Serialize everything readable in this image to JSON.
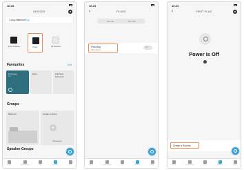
{
  "colors": {
    "accent": "#3aa3d8",
    "highlight": "#f08a55"
  },
  "screen1": {
    "time": "16:23",
    "title": "DEVICES",
    "location_label": "1 plug Hatterned",
    "location_value": "Plug",
    "device_types": [
      {
        "label": "Echo & Alexa",
        "icon": "echo-icon"
      },
      {
        "label": "Plugs",
        "icon": "plug-icon"
      },
      {
        "label": "All Devices",
        "icon": "list-icon"
      }
    ],
    "favourites_heading": "Favourites",
    "edit_label": "Edit",
    "favourites": [
      {
        "title": "First plug",
        "subtitle": "Off"
      },
      {
        "title": "Echo"
      },
      {
        "title": "Add New Favourite"
      }
    ],
    "groups_heading": "Groups",
    "groups": [
      {
        "title": "Bedroom"
      },
      {
        "title": "Create a Group",
        "sub": "New Group"
      }
    ],
    "speaker_groups_heading": "Speaker Groups",
    "tabs": [
      "Home",
      "Communicate",
      "Play",
      "Devices",
      "More"
    ]
  },
  "screen2": {
    "time": "16:23",
    "title": "PLUGS",
    "segments": [
      "ALL ON",
      "ALL OFF"
    ],
    "plug_name": "First plug",
    "plug_subtitle": "Office Device",
    "toggle_label": "Off",
    "tabs": [
      "Home",
      "Communicate",
      "Play",
      "Devices",
      "More"
    ]
  },
  "screen3": {
    "time": "16:23",
    "title": "FIRST PLUG",
    "power_status": "Power is Off",
    "routine_label": "Create a Routine",
    "tabs": [
      "Home",
      "Communicate",
      "Play",
      "Devices",
      "More"
    ]
  }
}
